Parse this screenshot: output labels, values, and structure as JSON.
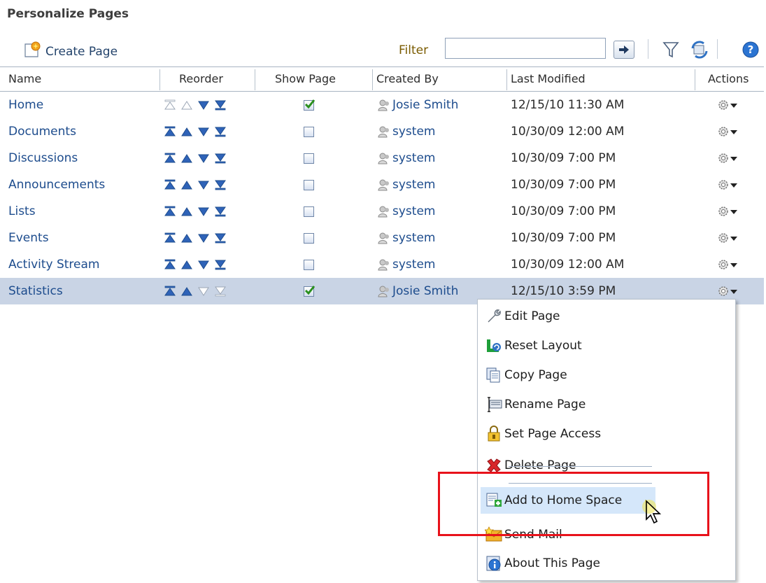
{
  "title": "Personalize Pages",
  "toolbar": {
    "create_page": "Create Page",
    "filter_label": "Filter",
    "filter_value": ""
  },
  "columns": [
    "Name",
    "Reorder",
    "Show Page",
    "Created By",
    "Last Modified",
    "Actions"
  ],
  "rows": [
    {
      "name": "Home",
      "show": true,
      "created_by": "Josie Smith",
      "modified": "12/15/10 11:30 AM"
    },
    {
      "name": "Documents",
      "show": false,
      "created_by": "system",
      "modified": "10/30/09 12:00 AM"
    },
    {
      "name": "Discussions",
      "show": false,
      "created_by": "system",
      "modified": "10/30/09 7:00 PM"
    },
    {
      "name": "Announcements",
      "show": false,
      "created_by": "system",
      "modified": "10/30/09 7:00 PM"
    },
    {
      "name": "Lists",
      "show": false,
      "created_by": "system",
      "modified": "10/30/09 7:00 PM"
    },
    {
      "name": "Events",
      "show": false,
      "created_by": "system",
      "modified": "10/30/09 7:00 PM"
    },
    {
      "name": "Activity Stream",
      "show": false,
      "created_by": "system",
      "modified": "10/30/09 12:00 AM"
    },
    {
      "name": "Statistics",
      "show": true,
      "created_by": "Josie Smith",
      "modified": "12/15/10 3:59 PM",
      "selected": true
    }
  ],
  "menu": [
    {
      "label": "Edit Page",
      "icon": "wrench-icon"
    },
    {
      "label": "Reset Layout",
      "icon": "reset-layout-icon"
    },
    {
      "label": "Copy Page",
      "icon": "copy-icon"
    },
    {
      "label": "Rename Page",
      "icon": "rename-icon"
    },
    {
      "label": "Set Page Access",
      "icon": "lock-icon"
    },
    {
      "label": "Delete Page",
      "icon": "delete-icon"
    },
    {
      "label": "Add to Home Space",
      "icon": "add-page-icon"
    },
    {
      "label": "Send Mail",
      "icon": "mail-icon"
    },
    {
      "label": "About This Page",
      "icon": "info-icon"
    }
  ],
  "colors": {
    "link": "#1d4c8d",
    "selected_row": "#c9d4e5",
    "menu_hover": "#d5e7fa",
    "highlight": "#e8121b"
  }
}
